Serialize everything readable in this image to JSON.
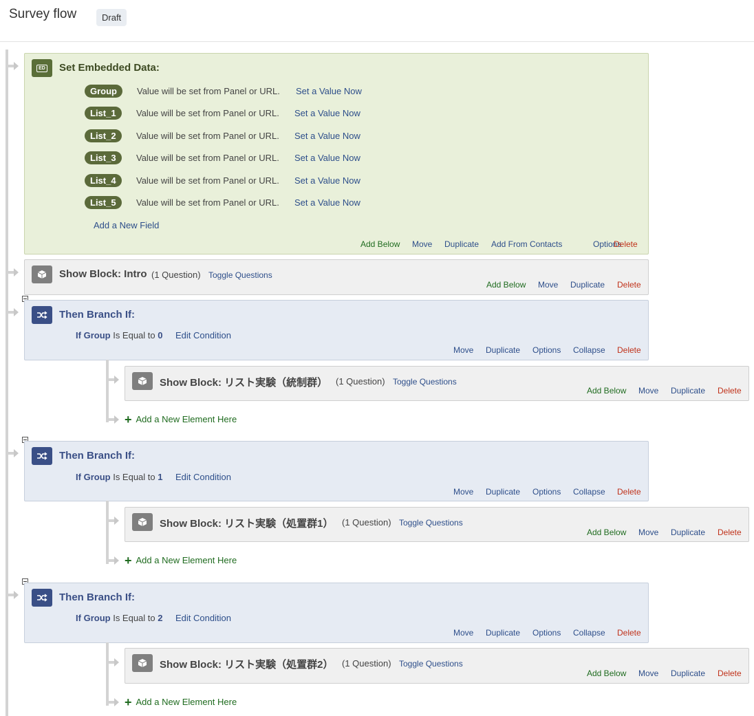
{
  "header": {
    "title": "Survey flow",
    "status_badge": "Draft"
  },
  "embedded": {
    "heading": "Set Embedded Data:",
    "icon_label": "ED",
    "fields": [
      {
        "name": "Group",
        "value_text": "Value will be set from Panel or URL.",
        "action": "Set a Value Now"
      },
      {
        "name": "List_1",
        "value_text": "Value will be set from Panel or URL.",
        "action": "Set a Value Now"
      },
      {
        "name": "List_2",
        "value_text": "Value will be set from Panel or URL.",
        "action": "Set a Value Now"
      },
      {
        "name": "List_3",
        "value_text": "Value will be set from Panel or URL.",
        "action": "Set a Value Now"
      },
      {
        "name": "List_4",
        "value_text": "Value will be set from Panel or URL.",
        "action": "Set a Value Now"
      },
      {
        "name": "List_5",
        "value_text": "Value will be set from Panel or URL.",
        "action": "Set a Value Now"
      }
    ],
    "add_field": "Add a New Field",
    "actions": [
      "Add Below",
      "Move",
      "Duplicate",
      "Add From Contacts",
      "Options",
      "Delete"
    ]
  },
  "intro_block": {
    "heading": "Show Block: Intro",
    "question_count": "(1 Question)",
    "toggle": "Toggle Questions",
    "actions": [
      "Add Below",
      "Move",
      "Duplicate",
      "Delete"
    ]
  },
  "branches": [
    {
      "heading": "Then Branch If:",
      "condition": {
        "if": "If",
        "field": "Group",
        "operator": "Is Equal to",
        "value": "0",
        "edit": "Edit Condition"
      },
      "actions": [
        "Move",
        "Duplicate",
        "Options",
        "Collapse",
        "Delete"
      ],
      "block": {
        "heading": "Show Block: リスト実験（統制群）",
        "question_count": "(1 Question)",
        "toggle": "Toggle Questions",
        "actions": [
          "Add Below",
          "Move",
          "Duplicate",
          "Delete"
        ]
      },
      "add_element": "Add a New Element Here"
    },
    {
      "heading": "Then Branch If:",
      "condition": {
        "if": "If",
        "field": "Group",
        "operator": "Is Equal to",
        "value": "1",
        "edit": "Edit Condition"
      },
      "actions": [
        "Move",
        "Duplicate",
        "Options",
        "Collapse",
        "Delete"
      ],
      "block": {
        "heading": "Show Block: リスト実験（処置群1）",
        "question_count": "(1 Question)",
        "toggle": "Toggle Questions",
        "actions": [
          "Add Below",
          "Move",
          "Duplicate",
          "Delete"
        ]
      },
      "add_element": "Add a New Element Here"
    },
    {
      "heading": "Then Branch If:",
      "condition": {
        "if": "If",
        "field": "Group",
        "operator": "Is Equal to",
        "value": "2",
        "edit": "Edit Condition"
      },
      "actions": [
        "Move",
        "Duplicate",
        "Options",
        "Collapse",
        "Delete"
      ],
      "block": {
        "heading": "Show Block: リスト実験（処置群2）",
        "question_count": "(1 Question)",
        "toggle": "Toggle Questions",
        "actions": [
          "Add Below",
          "Move",
          "Duplicate",
          "Delete"
        ]
      },
      "add_element": "Add a New Element Here"
    }
  ]
}
